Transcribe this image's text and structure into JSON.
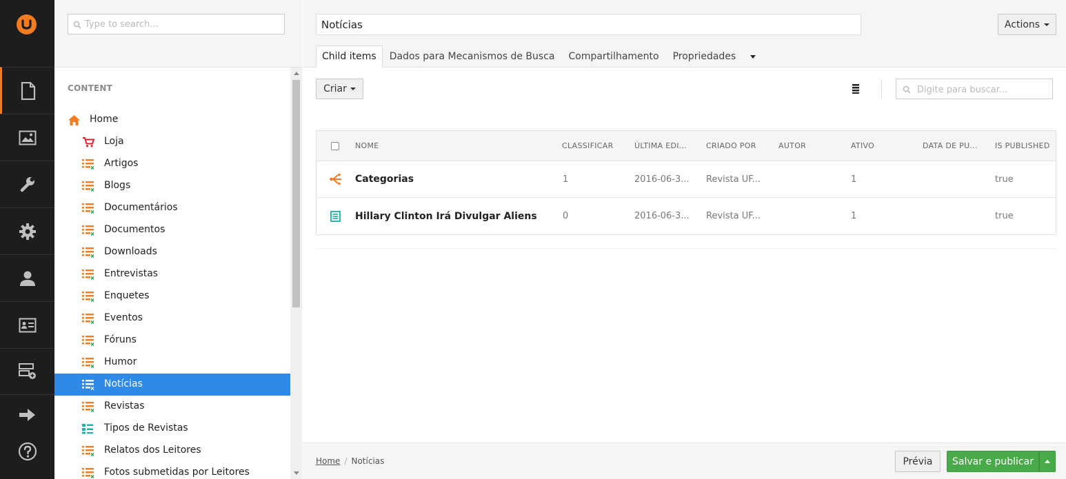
{
  "colors": {
    "accent": "#f37c20",
    "selected": "#2e8ae6",
    "publish": "#49aa49",
    "appbar": "#1d1d1d"
  },
  "appbar": {
    "sections": [
      {
        "name": "content-icon",
        "active": true
      },
      {
        "name": "media-icon",
        "active": false
      },
      {
        "name": "settings-wrench-icon",
        "active": false
      },
      {
        "name": "developer-gear-icon",
        "active": false
      },
      {
        "name": "users-icon",
        "active": false
      },
      {
        "name": "members-icon",
        "active": false
      },
      {
        "name": "forms-icon",
        "active": false
      }
    ],
    "bottom": [
      "exit-arrow-icon",
      "help-icon"
    ]
  },
  "tree": {
    "search_placeholder": "Type to search...",
    "section_label": "CONTENT",
    "nodes": [
      {
        "label": "Home",
        "icon": "home-icon",
        "level": 0
      },
      {
        "label": "Loja",
        "icon": "cart-icon",
        "level": 1
      },
      {
        "label": "Artigos",
        "icon": "list-icon",
        "level": 1
      },
      {
        "label": "Blogs",
        "icon": "list-icon",
        "level": 1
      },
      {
        "label": "Documentários",
        "icon": "list-icon",
        "level": 1
      },
      {
        "label": "Documentos",
        "icon": "list-icon",
        "level": 1
      },
      {
        "label": "Downloads",
        "icon": "list-icon",
        "level": 1
      },
      {
        "label": "Entrevistas",
        "icon": "list-icon",
        "level": 1
      },
      {
        "label": "Enquetes",
        "icon": "list-icon",
        "level": 1
      },
      {
        "label": "Eventos",
        "icon": "list-icon",
        "level": 1
      },
      {
        "label": "Fóruns",
        "icon": "list-icon",
        "level": 1
      },
      {
        "label": "Humor",
        "icon": "list-icon",
        "level": 1
      },
      {
        "label": "Notícias",
        "icon": "list-icon",
        "level": 1,
        "selected": true
      },
      {
        "label": "Revistas",
        "icon": "list-icon",
        "level": 1
      },
      {
        "label": "Tipos de Revistas",
        "icon": "grid-list-icon",
        "level": 1
      },
      {
        "label": "Relatos dos Leitores",
        "icon": "list-icon",
        "level": 1
      },
      {
        "label": "Fotos submetidas por Leitores",
        "icon": "list-icon",
        "level": 1
      }
    ]
  },
  "editor": {
    "page_name": "Notícias",
    "actions_label": "Actions",
    "tabs": [
      "Child items",
      "Dados para Mecanismos de Busca",
      "Compartilhamento",
      "Propriedades"
    ],
    "active_tab": 0,
    "create_label": "Criar",
    "list_search_placeholder": "Digite para buscar...",
    "columns": [
      "NOME",
      "CLASSIFICAR",
      "ÚLTIMA EDI...",
      "CRIADO POR",
      "AUTOR",
      "ATIVO",
      "DATA DE PU...",
      "IS PUBLISHED"
    ],
    "rows": [
      {
        "icon": "categories-branch-icon",
        "name": "Categorias",
        "sort": "1",
        "edited": "2016-06-3...",
        "creator": "Revista UF...",
        "author": "",
        "active": "1",
        "pubdate": "",
        "published": "true"
      },
      {
        "icon": "article-icon",
        "name": "Hillary Clinton Irá Divulgar Aliens",
        "sort": "0",
        "edited": "2016-06-3...",
        "creator": "Revista UF...",
        "author": "",
        "active": "1",
        "pubdate": "",
        "published": "true"
      }
    ],
    "breadcrumb": {
      "home": "Home",
      "separator": "/",
      "current": "Notícias"
    },
    "preview_label": "Prévia",
    "publish_label": "Salvar e publicar"
  }
}
